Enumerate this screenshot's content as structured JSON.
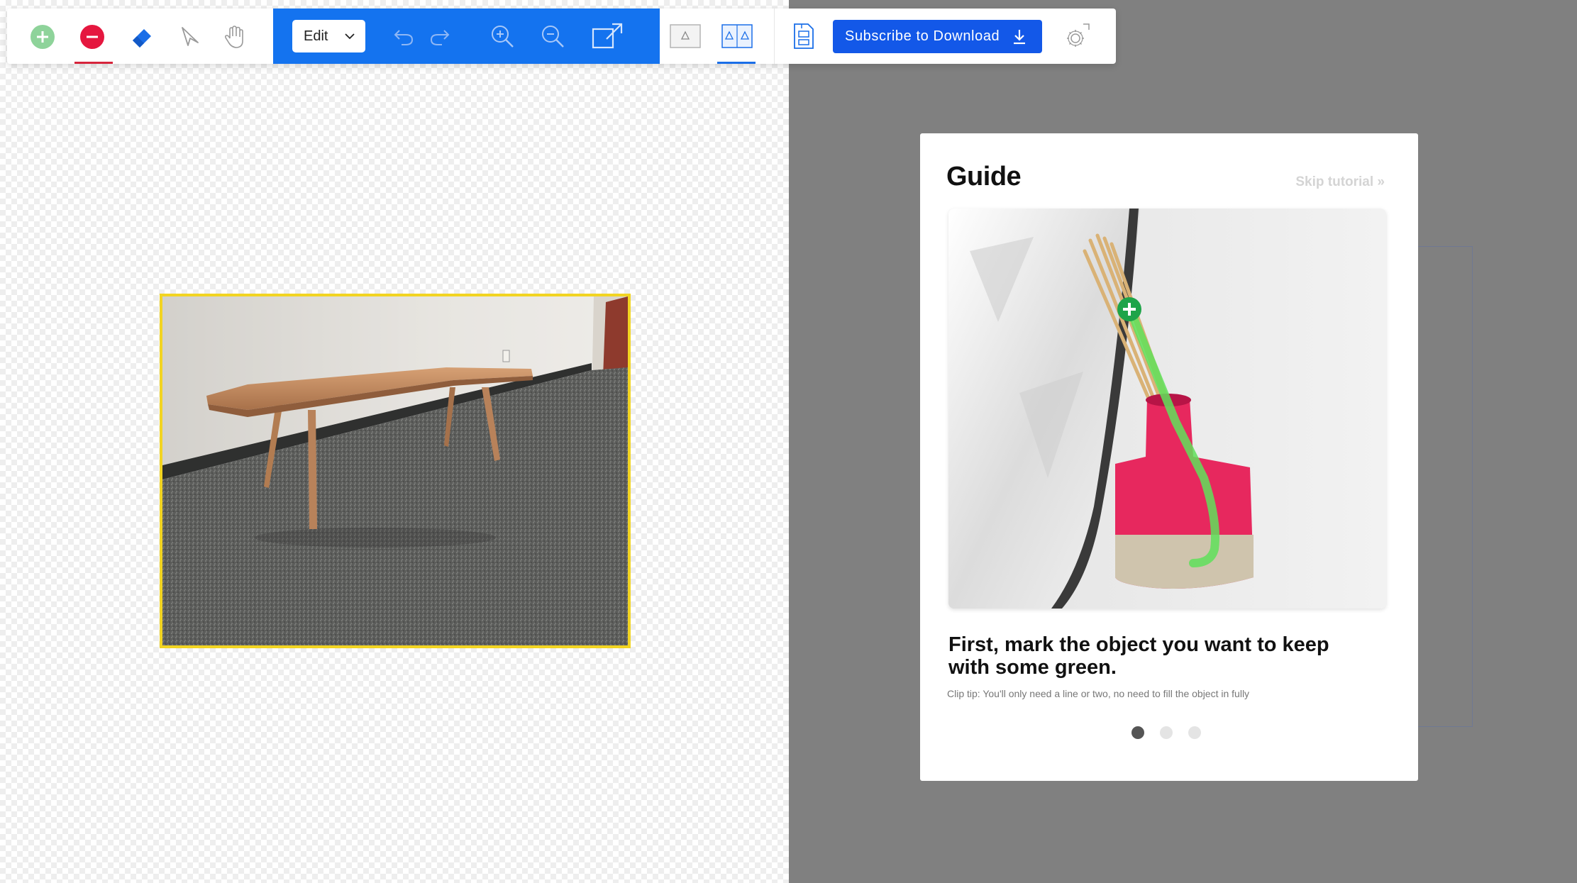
{
  "toolbar": {
    "tools": [
      {
        "name": "keep-brush",
        "icon": "plus-circle-icon",
        "color": "#8ed39a"
      },
      {
        "name": "remove-brush",
        "icon": "minus-circle-icon",
        "color": "#e5173f",
        "active": true
      },
      {
        "name": "eraser",
        "icon": "eraser-icon",
        "color": "#1a6ee8"
      },
      {
        "name": "select",
        "icon": "cursor-arrow-icon"
      },
      {
        "name": "pan",
        "icon": "hand-icon"
      }
    ],
    "mode_select": {
      "value": "Edit"
    },
    "actions": [
      "undo-icon",
      "redo-icon",
      "zoom-in-icon",
      "zoom-out-icon",
      "fit-screen-icon"
    ],
    "view_modes": [
      {
        "icon": "single-view-icon",
        "active": false
      },
      {
        "icon": "side-by-side-view-icon",
        "active": true
      }
    ],
    "save_icon": "save-document-icon",
    "subscribe_label": "Subscribe to Download",
    "settings_icon": "settings-gear-icon",
    "accent_color": "#1473ef",
    "button_color": "#1358e8"
  },
  "canvas": {
    "selection_color": "#f2d422",
    "right_background": "#808080"
  },
  "guide": {
    "title": "Guide",
    "skip_label": "Skip tutorial »",
    "heading": "First, mark the object you want to keep with some green.",
    "tip": "Clip tip: You'll only need a line or two, no need to fill the object in fully",
    "current_step": 1,
    "total_steps": 3
  }
}
